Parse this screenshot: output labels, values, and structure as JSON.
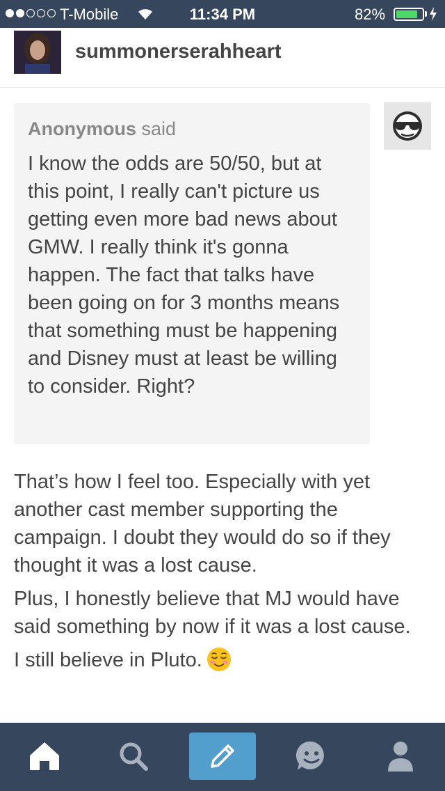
{
  "status_bar": {
    "carrier": "T-Mobile",
    "time": "11:34 PM",
    "battery_percent": "82%",
    "battery_level": 0.82,
    "signal_bars": 2,
    "signal_total": 5
  },
  "post": {
    "username": "summonerserahheart"
  },
  "ask": {
    "asker": "Anonymous",
    "said_label": "said",
    "question": "I know the odds are 50/50, but at this point, I really can't picture us getting even more bad news about GMW. I really think it's gonna happen. The fact that talks have been going on for 3 months means that something must be happening and Disney must at least be willing to consider. Right?"
  },
  "answer": {
    "paragraph_1": "That’s how I feel too. Especially with yet another cast member supporting the campaign. I doubt they would do so if they thought it was a lost cause.",
    "paragraph_2": "Plus, I honestly believe that MJ would have said something by now if it was a lost cause.",
    "paragraph_3": "I still believe in Pluto.",
    "emoji": "relieved-smile-emoji"
  },
  "tab_bar": {
    "tabs": [
      "home-icon",
      "search-icon",
      "compose-icon",
      "activity-icon",
      "account-icon"
    ],
    "colors": {
      "background": "#36465d",
      "compose": "#529ecc",
      "active": "#ffffff",
      "inactive": "#a8b1be"
    }
  }
}
